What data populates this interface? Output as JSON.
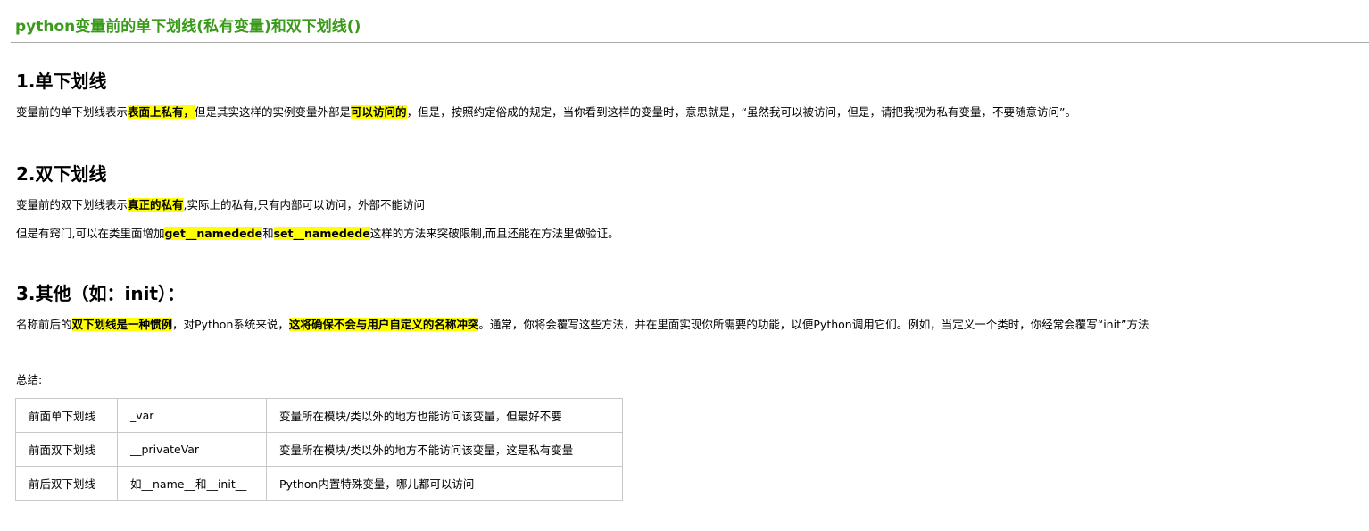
{
  "article": {
    "title": "python变量前的单下划线(私有变量)和双下划线()"
  },
  "section1": {
    "heading": "1.单下划线",
    "para": {
      "t1": "变量前的单下划线表示",
      "h1": "表面上私有，",
      "t2": "但是其实这样的实例变量外部是",
      "h2": "可以访问的",
      "t3": "，但是，按照约定俗成的规定，当你看到这样的变量时，意思就是，“虽然我可以被访问，但是，请把我视为私有变量，不要随意访问”。"
    }
  },
  "section2": {
    "heading": "2.双下划线",
    "para1": {
      "t1": "变量前的双下划线表示",
      "h1": "真正的私有",
      "t2": ",实际上的私有,只有内部可以访问，外部不能访问"
    },
    "para2": {
      "t1": "但是有窍门,可以在类里面增加",
      "h1": "get__namedede",
      "t2": "和",
      "h2": "set__namedede",
      "t3": "这样的方法来突破限制,而且还能在方法里做验证。"
    }
  },
  "section3": {
    "heading": "3.其他（如：init）：",
    "para": {
      "t1": "名称前后的",
      "h1": "双下划线是一种惯例",
      "t2": "，对Python系统来说，",
      "h2": "这将确保不会与用户自定义的名称冲突",
      "t3": "。通常，你将会覆写这些方法，并在里面实现你所需要的功能，以便Python调用它们。例如，当定义一个类时，你经常会覆写“init”方法"
    }
  },
  "summary": {
    "label": "总结:",
    "rows": [
      [
        "前面单下划线",
        "_var",
        "变量所在模块/类以外的地方也能访问该变量，但最好不要"
      ],
      [
        "前面双下划线",
        "__privateVar",
        "变量所在模块/类以外的地方不能访问该变量，这是私有变量"
      ],
      [
        "前后双下划线",
        "如__name__和__init__",
        "Python内置特殊变量，哪儿都可以访问"
      ]
    ]
  },
  "colors": {
    "title": "#3a9a1a",
    "highlight": "#ffff00",
    "rule": "#aaaaaa",
    "table_border": "#c8c8c8"
  }
}
